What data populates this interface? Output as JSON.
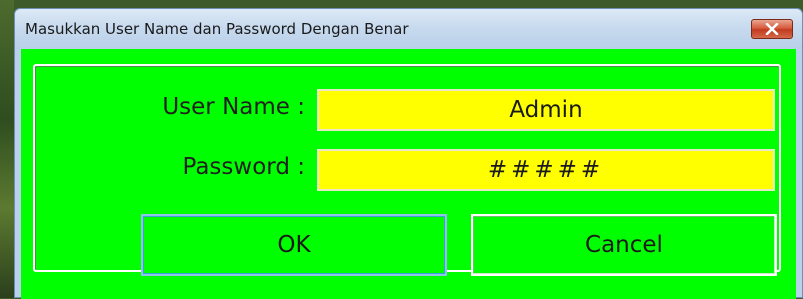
{
  "window": {
    "title": "Masukkan User Name dan Password Dengan Benar",
    "close_icon": "close-icon",
    "background_color": "#00ff00",
    "field_color": "#ffff00"
  },
  "form": {
    "username_label": "User Name :",
    "username_value": "Admin",
    "password_label": "Password :",
    "password_value": "#####"
  },
  "buttons": {
    "ok_label": "OK",
    "cancel_label": "Cancel"
  }
}
